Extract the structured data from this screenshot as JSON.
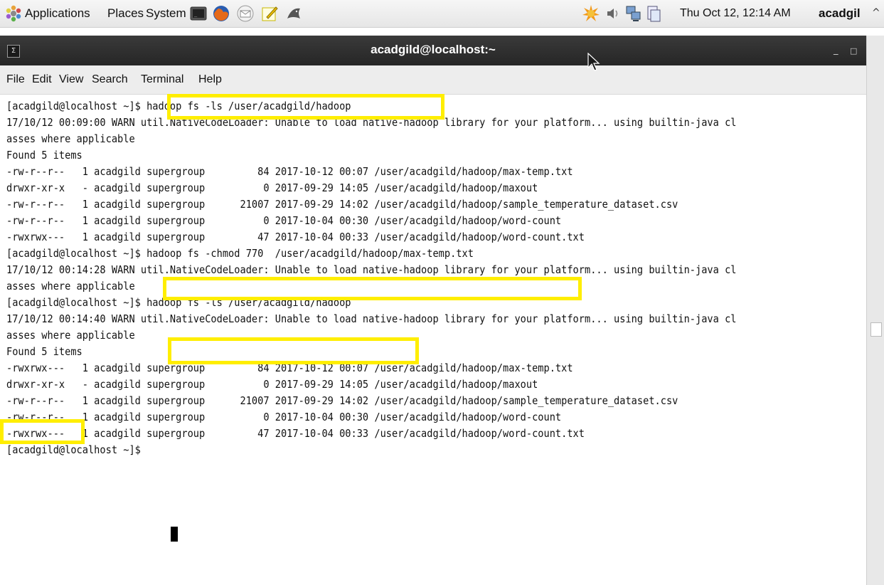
{
  "panel": {
    "menus": [
      "Applications",
      "Places",
      "System"
    ],
    "clock": "Thu Oct 12, 12:14 AM",
    "user": "acadgil"
  },
  "window": {
    "title": "acadgild@localhost:~"
  },
  "menubar": [
    "File",
    "Edit",
    "View",
    "Search",
    "Terminal",
    "Help"
  ],
  "terminal": {
    "lines": [
      "[acadgild@localhost ~]$ hadoop fs -ls /user/acadgild/hadoop",
      "17/10/12 00:09:00 WARN util.NativeCodeLoader: Unable to load native-hadoop library for your platform... using builtin-java cl",
      "asses where applicable",
      "Found 5 items",
      "-rw-r--r--   1 acadgild supergroup         84 2017-10-12 00:07 /user/acadgild/hadoop/max-temp.txt",
      "drwxr-xr-x   - acadgild supergroup          0 2017-09-29 14:05 /user/acadgild/hadoop/maxout",
      "-rw-r--r--   1 acadgild supergroup      21007 2017-09-29 14:02 /user/acadgild/hadoop/sample_temperature_dataset.csv",
      "-rw-r--r--   1 acadgild supergroup          0 2017-10-04 00:30 /user/acadgild/hadoop/word-count",
      "-rwxrwx---   1 acadgild supergroup         47 2017-10-04 00:33 /user/acadgild/hadoop/word-count.txt",
      "[acadgild@localhost ~]$ hadoop fs -chmod 770  /user/acadgild/hadoop/max-temp.txt",
      "17/10/12 00:14:28 WARN util.NativeCodeLoader: Unable to load native-hadoop library for your platform... using builtin-java cl",
      "asses where applicable",
      "[acadgild@localhost ~]$ hadoop fs -ls /user/acadgild/hadoop",
      "17/10/12 00:14:40 WARN util.NativeCodeLoader: Unable to load native-hadoop library for your platform... using builtin-java cl",
      "asses where applicable",
      "Found 5 items",
      "-rwxrwx---   1 acadgild supergroup         84 2017-10-12 00:07 /user/acadgild/hadoop/max-temp.txt",
      "drwxr-xr-x   - acadgild supergroup          0 2017-09-29 14:05 /user/acadgild/hadoop/maxout",
      "-rw-r--r--   1 acadgild supergroup      21007 2017-09-29 14:02 /user/acadgild/hadoop/sample_temperature_dataset.csv",
      "-rw-r--r--   1 acadgild supergroup          0 2017-10-04 00:30 /user/acadgild/hadoop/word-count",
      "-rwxrwx---   1 acadgild supergroup         47 2017-10-04 00:33 /user/acadgild/hadoop/word-count.txt",
      "[acadgild@localhost ~]$ "
    ],
    "highlight_color": "#ffee00"
  },
  "icons": {
    "panel": [
      "applications-icon",
      "terminal-launcher-icon",
      "firefox-icon",
      "email-icon",
      "text-editor-icon",
      "fish-icon",
      "update-notifier-icon",
      "volume-icon",
      "network-icon",
      "clipboard-icon"
    ]
  }
}
